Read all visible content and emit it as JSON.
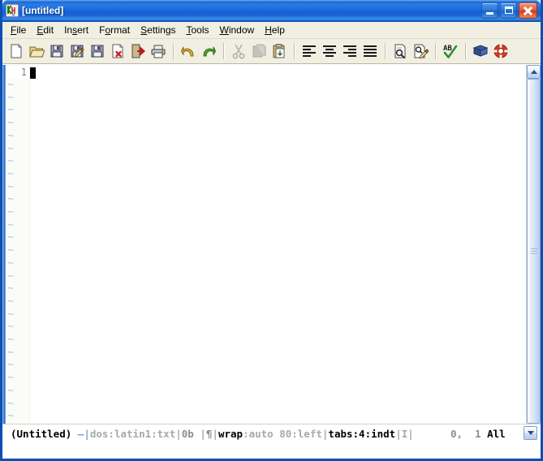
{
  "window": {
    "title": "[untitled]",
    "app_icon": "editor-app-icon",
    "controls": {
      "minimize": "Minimize",
      "maximize": "Maximize",
      "close": "Close"
    },
    "colors": {
      "title_bar_blue": "#1763d2",
      "frame_blue": "#0a4fb5",
      "close_red": "#cf3f1d",
      "chrome": "#f1efe2",
      "tilde_blue": "#9ec8f0",
      "line_number_gray": "#808080"
    }
  },
  "menu": {
    "items": [
      {
        "label": "File",
        "mnemonic": "F"
      },
      {
        "label": "Edit",
        "mnemonic": "E"
      },
      {
        "label": "Insert",
        "mnemonic": "s"
      },
      {
        "label": "Format",
        "mnemonic": "o"
      },
      {
        "label": "Settings",
        "mnemonic": "S"
      },
      {
        "label": "Tools",
        "mnemonic": "T"
      },
      {
        "label": "Window",
        "mnemonic": "W"
      },
      {
        "label": "Help",
        "mnemonic": "H"
      }
    ]
  },
  "toolbar": {
    "groups": [
      {
        "buttons": [
          {
            "icon": "new-file-icon",
            "label": "New",
            "disabled": false
          },
          {
            "icon": "open-folder-icon",
            "label": "Open",
            "disabled": false
          },
          {
            "icon": "save-icon",
            "label": "Save",
            "disabled": false
          },
          {
            "icon": "save-as-icon",
            "label": "Save As",
            "disabled": false
          },
          {
            "icon": "save-all-icon",
            "label": "Save All",
            "disabled": false
          },
          {
            "icon": "close-file-icon",
            "label": "Close",
            "disabled": false
          },
          {
            "icon": "exit-icon",
            "label": "Exit",
            "disabled": false
          },
          {
            "icon": "print-icon",
            "label": "Print",
            "disabled": false
          }
        ]
      },
      {
        "buttons": [
          {
            "icon": "undo-icon",
            "label": "Undo",
            "disabled": false
          },
          {
            "icon": "redo-icon",
            "label": "Redo",
            "disabled": false
          }
        ]
      },
      {
        "buttons": [
          {
            "icon": "cut-icon",
            "label": "Cut",
            "disabled": true
          },
          {
            "icon": "copy-icon",
            "label": "Copy",
            "disabled": true
          },
          {
            "icon": "paste-icon",
            "label": "Paste",
            "disabled": false
          }
        ]
      },
      {
        "buttons": [
          {
            "icon": "align-left-icon",
            "label": "Align Left",
            "disabled": false
          },
          {
            "icon": "align-center-icon",
            "label": "Align Center",
            "disabled": false
          },
          {
            "icon": "align-right-icon",
            "label": "Align Right",
            "disabled": false
          },
          {
            "icon": "align-justify-icon",
            "label": "Justify",
            "disabled": false
          }
        ]
      },
      {
        "buttons": [
          {
            "icon": "find-icon",
            "label": "Find",
            "disabled": false
          },
          {
            "icon": "replace-icon",
            "label": "Replace",
            "disabled": false
          }
        ]
      },
      {
        "buttons": [
          {
            "icon": "spellcheck-icon",
            "label": "Spell Check",
            "disabled": false
          }
        ]
      },
      {
        "buttons": [
          {
            "icon": "dictionary-icon",
            "label": "Dictionary",
            "disabled": false
          },
          {
            "icon": "help-ring-icon",
            "label": "Help",
            "disabled": false
          }
        ]
      }
    ]
  },
  "editor": {
    "line_number": "1",
    "content": "",
    "empty_line_marker": "~",
    "empty_marker_count": 28,
    "caret_visible": true
  },
  "scrollbar": {
    "up_arrow": "scroll-up",
    "down_arrow": "scroll-down",
    "thumb": "scroll-thumb"
  },
  "status_bar": {
    "segments": [
      {
        "text": "(Untitled) ",
        "style": "dark"
      },
      {
        "text": "–|",
        "style": "blue"
      },
      {
        "text": "dos:latin1:txt",
        "style": "gray"
      },
      {
        "text": "|",
        "style": "gray"
      },
      {
        "text": "0b",
        "style": "mid"
      },
      {
        "text": " |",
        "style": "gray"
      },
      {
        "text": "¶",
        "style": "mid"
      },
      {
        "text": "|",
        "style": "gray"
      },
      {
        "text": "wrap",
        "style": "dark"
      },
      {
        "text": ":auto 80:left",
        "style": "gray"
      },
      {
        "text": "|",
        "style": "gray"
      },
      {
        "text": "tabs:4:indt",
        "style": "dark"
      },
      {
        "text": "|",
        "style": "gray"
      },
      {
        "text": "I",
        "style": "gray"
      },
      {
        "text": "|",
        "style": "gray"
      },
      {
        "text": "      0,  1 ",
        "style": "mid"
      },
      {
        "text": "All",
        "style": "dark"
      }
    ],
    "file_name": "(Untitled)",
    "encoding": "dos:latin1:txt",
    "size": "0b",
    "wrap": "wrap:auto 80:left",
    "tabs": "tabs:4:indt",
    "mode": "I",
    "column": "0",
    "line": "1",
    "view": "All"
  }
}
